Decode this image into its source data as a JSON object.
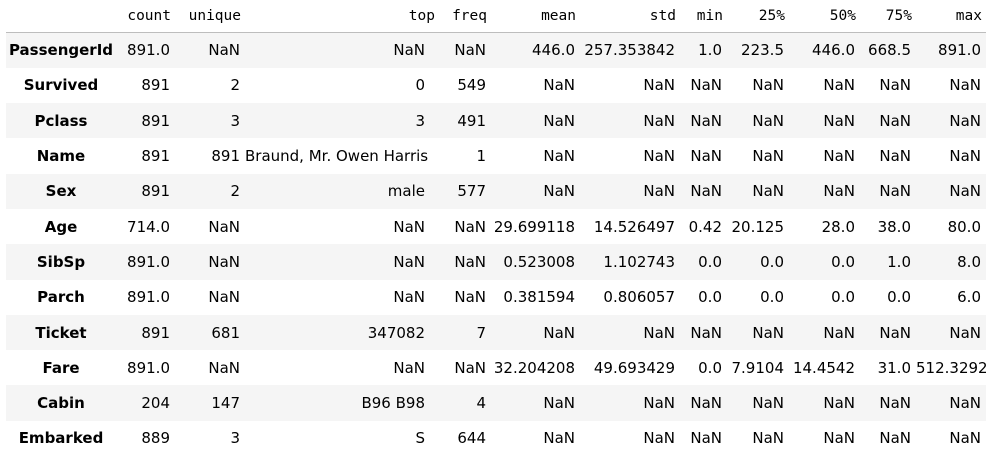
{
  "columns": [
    "count",
    "unique",
    "top",
    "freq",
    "mean",
    "std",
    "min",
    "25%",
    "50%",
    "75%",
    "max"
  ],
  "rows": [
    {
      "index": "PassengerId",
      "cells": [
        "891.0",
        "NaN",
        "NaN",
        "NaN",
        "446.0",
        "257.353842",
        "1.0",
        "223.5",
        "446.0",
        "668.5",
        "891.0"
      ]
    },
    {
      "index": "Survived",
      "cells": [
        "891",
        "2",
        "0",
        "549",
        "NaN",
        "NaN",
        "NaN",
        "NaN",
        "NaN",
        "NaN",
        "NaN"
      ]
    },
    {
      "index": "Pclass",
      "cells": [
        "891",
        "3",
        "3",
        "491",
        "NaN",
        "NaN",
        "NaN",
        "NaN",
        "NaN",
        "NaN",
        "NaN"
      ]
    },
    {
      "index": "Name",
      "cells": [
        "891",
        "891",
        "Braund, Mr. Owen Harris",
        "1",
        "NaN",
        "NaN",
        "NaN",
        "NaN",
        "NaN",
        "NaN",
        "NaN"
      ]
    },
    {
      "index": "Sex",
      "cells": [
        "891",
        "2",
        "male",
        "577",
        "NaN",
        "NaN",
        "NaN",
        "NaN",
        "NaN",
        "NaN",
        "NaN"
      ]
    },
    {
      "index": "Age",
      "cells": [
        "714.0",
        "NaN",
        "NaN",
        "NaN",
        "29.699118",
        "14.526497",
        "0.42",
        "20.125",
        "28.0",
        "38.0",
        "80.0"
      ]
    },
    {
      "index": "SibSp",
      "cells": [
        "891.0",
        "NaN",
        "NaN",
        "NaN",
        "0.523008",
        "1.102743",
        "0.0",
        "0.0",
        "0.0",
        "1.0",
        "8.0"
      ]
    },
    {
      "index": "Parch",
      "cells": [
        "891.0",
        "NaN",
        "NaN",
        "NaN",
        "0.381594",
        "0.806057",
        "0.0",
        "0.0",
        "0.0",
        "0.0",
        "6.0"
      ]
    },
    {
      "index": "Ticket",
      "cells": [
        "891",
        "681",
        "347082",
        "7",
        "NaN",
        "NaN",
        "NaN",
        "NaN",
        "NaN",
        "NaN",
        "NaN"
      ]
    },
    {
      "index": "Fare",
      "cells": [
        "891.0",
        "NaN",
        "NaN",
        "NaN",
        "32.204208",
        "49.693429",
        "0.0",
        "7.9104",
        "14.4542",
        "31.0",
        "512.3292"
      ]
    },
    {
      "index": "Cabin",
      "cells": [
        "204",
        "147",
        "B96 B98",
        "4",
        "NaN",
        "NaN",
        "NaN",
        "NaN",
        "NaN",
        "NaN",
        "NaN"
      ]
    },
    {
      "index": "Embarked",
      "cells": [
        "889",
        "3",
        "S",
        "644",
        "NaN",
        "NaN",
        "NaN",
        "NaN",
        "NaN",
        "NaN",
        "NaN"
      ]
    }
  ],
  "colors": {
    "stripe": "#f5f5f5",
    "background": "#ffffff",
    "header_rule": "#bdbdbd",
    "text": "#000000"
  }
}
